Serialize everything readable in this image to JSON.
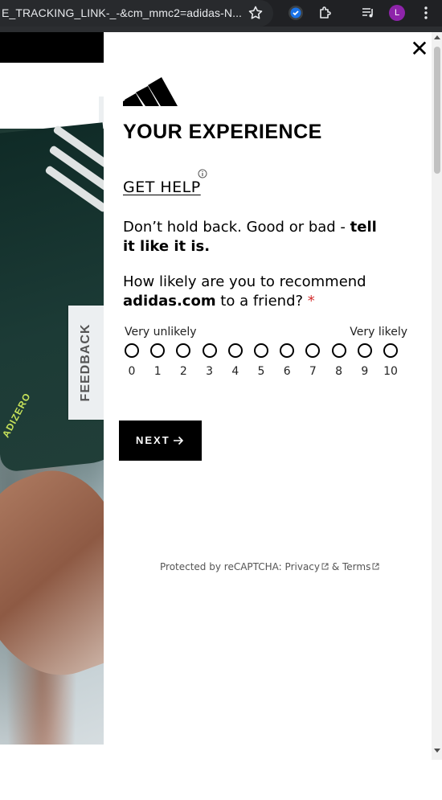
{
  "browser": {
    "url_text": "E_TRACKING_LINK-_-&cm_mmc2=adidas-N...",
    "profile_initial": "L"
  },
  "feedback_tab": {
    "label": "FEEDBACK"
  },
  "photo": {
    "brand_text": "ADIZERO"
  },
  "survey": {
    "title": "YOUR EXPERIENCE",
    "get_help": "GET HELP",
    "intro_plain": "Don’t hold back. Good or bad - ",
    "intro_bold": "tell it like it is.",
    "question_plain": "How likely are you to recommend ",
    "question_bold": "adidas.com",
    "question_tail": " to a friend? ",
    "required_mark": "*",
    "scale_low": "Very unlikely",
    "scale_high": "Very likely",
    "scale": [
      "0",
      "1",
      "2",
      "3",
      "4",
      "5",
      "6",
      "7",
      "8",
      "9",
      "10"
    ],
    "next_label": "NEXT",
    "recaptcha_prefix": "Protected by reCAPTCHA: ",
    "privacy": "Privacy",
    "amp": " & ",
    "terms": "Terms"
  },
  "colors": {
    "accent": "#000000",
    "required": "#d32f2f",
    "avatar": "#8e24aa"
  }
}
